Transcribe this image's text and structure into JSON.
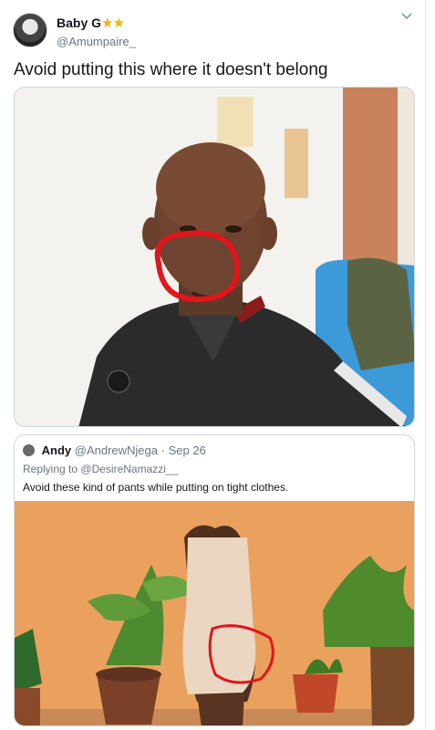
{
  "tweet": {
    "display_name": "Baby G",
    "stars": "★★",
    "handle": "@Amumpaire_",
    "text": "Avoid putting this where it doesn't belong"
  },
  "quoted_tweet": {
    "name": "Andy",
    "handle": "@AndrewNjega",
    "separator": "·",
    "date": "Sep 26",
    "replying_prefix": "Replying to",
    "replying_to": "@DesireNamazzi__",
    "text": "Avoid these kind of pants while putting on tight clothes."
  },
  "icons": {
    "more": "chevron-down-icon"
  },
  "colors": {
    "annotation_circle": "#e0161c",
    "star": "#f4b400",
    "handle_gray": "#657786",
    "wall_orange": "#e9a15d"
  }
}
